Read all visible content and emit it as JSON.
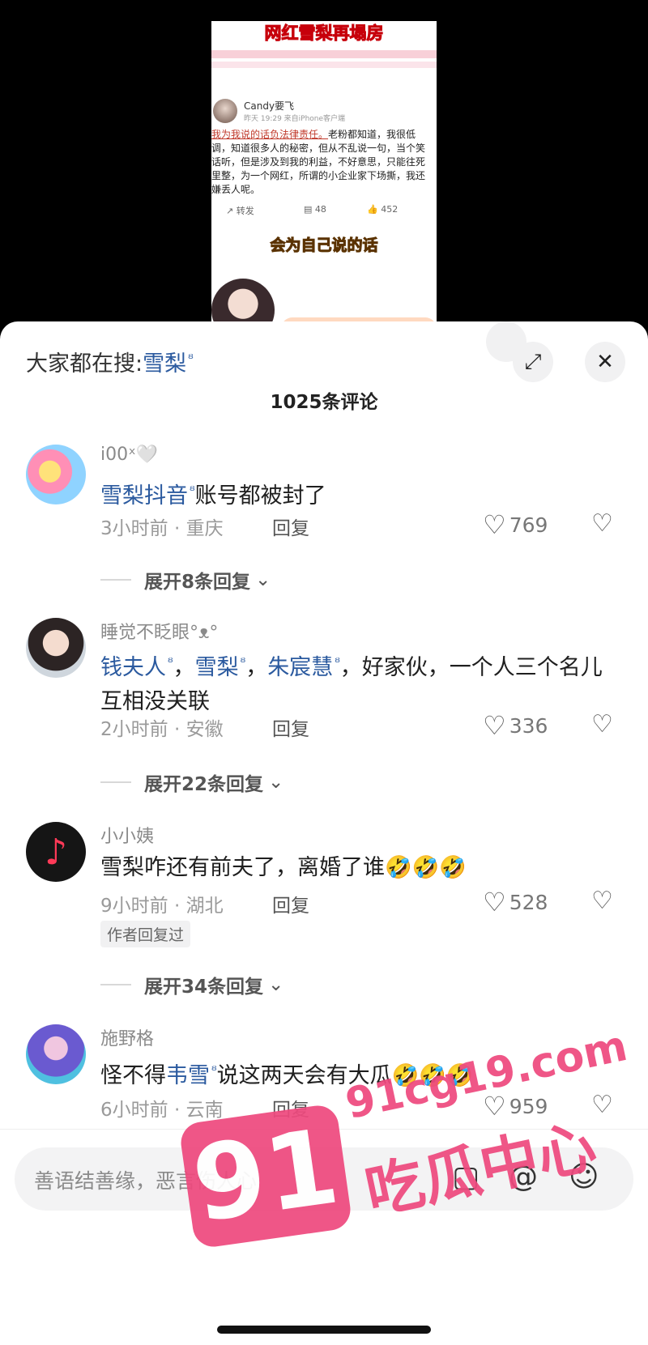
{
  "video": {
    "headline": "网红雪梨再塌房",
    "post_author": "Candy要飞",
    "post_meta": "昨天 19:29 来自iPhone客户端",
    "post_text_highlight": "我为我说的话负法律责任。",
    "post_text": "老粉都知道，我很低调，知道很多人的秘密，但从不乱说一句，当个笑话听，但是涉及到我的利益，不好意思，只能往死里整，为一个网红，所谓的小企业家下场撕，我还嫌丢人呢。",
    "repost": "转发",
    "comments": "48",
    "likes": "452",
    "caption": "会为自己说的话"
  },
  "header": {
    "search_prefix": "大家都在搜:",
    "search_keyword": "雪梨",
    "count": "1025条评论"
  },
  "comments": [
    {
      "user": "i00ˣ🤍",
      "pre": "",
      "kw": "雪梨抖音",
      "post": "账号都被封了",
      "meta": "3小时前 · 重庆",
      "reply": "回复",
      "likes": "769",
      "expand": "展开8条回复"
    },
    {
      "user": "睡觉不眨眼°ᴥ°",
      "kw1": "钱夫人",
      "kw2": "雪梨",
      "kw3": "朱宸慧",
      "sep": "，",
      "post": "，好家伙，一个人三个名儿互相没关联",
      "meta": "2小时前 · 安徽",
      "reply": "回复",
      "likes": "336",
      "expand": "展开22条回复"
    },
    {
      "user": "小小姨",
      "text": "雪梨咋还有前夫了，离婚了谁🤣🤣🤣",
      "meta": "9小时前 · 湖北",
      "reply": "回复",
      "likes": "528",
      "tag": "作者回复过",
      "expand": "展开34条回复"
    },
    {
      "user": "施野格",
      "pre": "怪不得",
      "kw": "韦雪",
      "post": "说这两天会有大瓜🤣🤣🤣",
      "meta": "6小时前 · 云南",
      "reply": "回复",
      "likes": "959"
    }
  ],
  "input": {
    "placeholder": "善语结善缘，恶言伤人心"
  },
  "watermark": {
    "number": "91",
    "domain": "91cg19.com",
    "brand": "吃瓜中心"
  },
  "colors": {
    "keyword": "#2b5a9f",
    "watermark": "#ee4a7e"
  }
}
